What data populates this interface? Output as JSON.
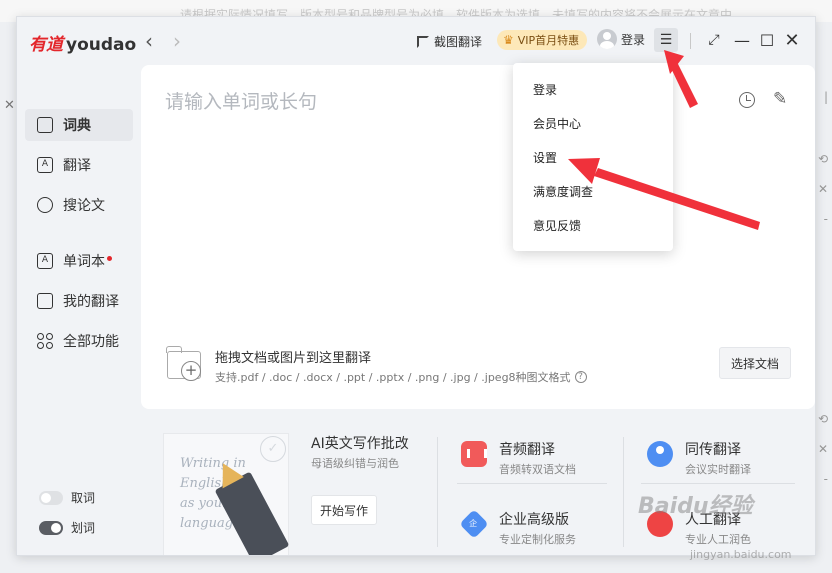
{
  "background": {
    "hint_text": "请根据实际情况填写，版本型号和品牌型号为必填，软件版本为选填，未填写的内容将不会展示在文章中"
  },
  "app": {
    "logo_cn": "有道",
    "logo_en": "youdao"
  },
  "titlebar": {
    "screenshot_translate": "截图翻译",
    "vip_label": "VIP首月特惠",
    "login_label": "登录"
  },
  "sidebar": {
    "items": [
      {
        "label": "词典",
        "icon": "dictionary-icon"
      },
      {
        "label": "翻译",
        "icon": "translate-icon"
      },
      {
        "label": "搜论文",
        "icon": "search-paper-icon"
      },
      {
        "label": "单词本",
        "icon": "wordbook-icon"
      },
      {
        "label": "我的翻译",
        "icon": "my-translation-icon"
      },
      {
        "label": "全部功能",
        "icon": "all-features-icon"
      }
    ],
    "toggles": [
      {
        "label": "取词",
        "state": "off"
      },
      {
        "label": "划词",
        "state": "on"
      }
    ]
  },
  "main": {
    "input_placeholder": "请输入单词或长句",
    "doc_title": "拖拽文档或图片到这里翻译",
    "doc_formats": "支持.pdf / .doc / .docx / .ppt / .pptx / .png / .jpg / .jpeg8种图文格式",
    "choose_doc": "选择文档"
  },
  "features": {
    "ai_writing": {
      "title": "AI英文写作批改",
      "sub": "母语级纠错与润色",
      "button": "开始写作",
      "image_text": [
        "Writing in",
        "English",
        "as your first",
        "language"
      ]
    },
    "audio": {
      "title": "音频翻译",
      "sub": "音频转双语文档"
    },
    "sync": {
      "title": "同传翻译",
      "sub": "会议实时翻译"
    },
    "enterprise": {
      "title": "企业高级版",
      "sub": "专业定制化服务",
      "icon_char": "企"
    },
    "human": {
      "title": "人工翻译",
      "sub": "专业人工润色"
    }
  },
  "dropdown": {
    "items": [
      "登录",
      "会员中心",
      "设置",
      "满意度调查",
      "意见反馈"
    ]
  },
  "watermark": {
    "main": "Baidu经验",
    "sub": "jingyan.baidu.com"
  },
  "colors": {
    "brand_red": "#e3262b",
    "annotation_red": "#f0313b"
  }
}
